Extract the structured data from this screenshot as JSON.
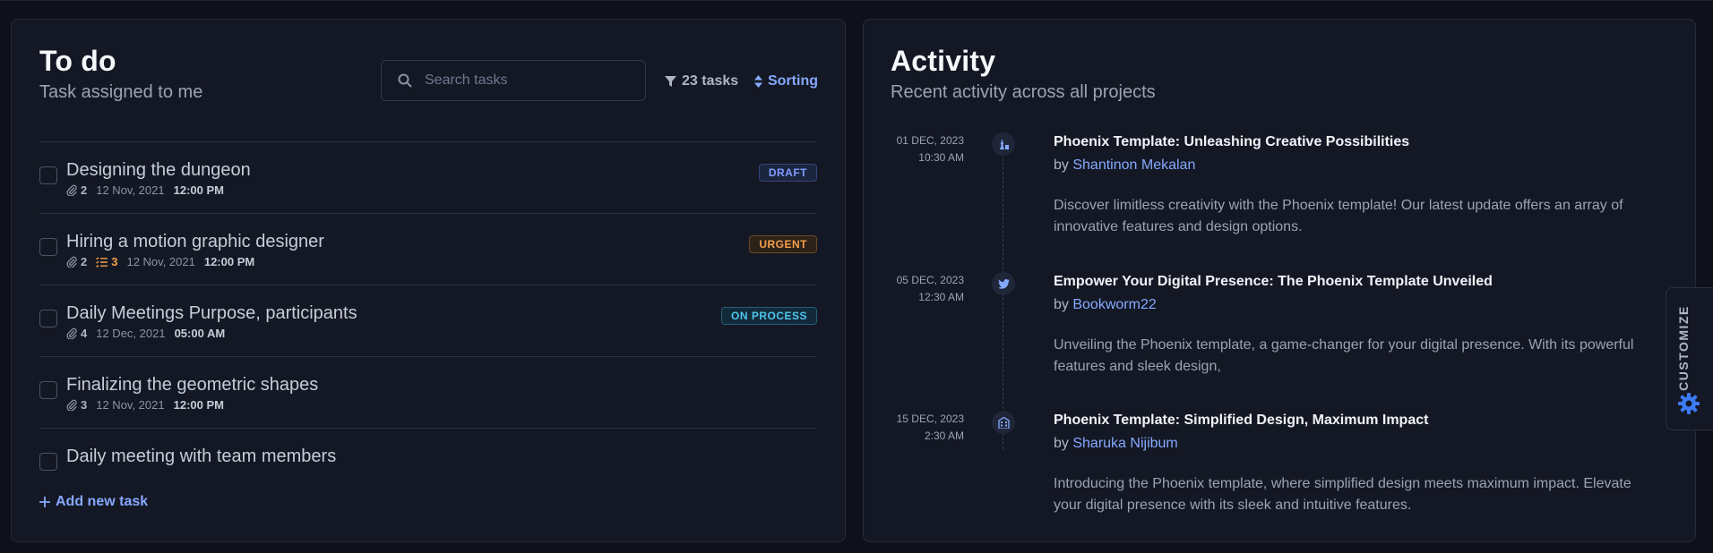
{
  "todo": {
    "title": "To do",
    "subtitle": "Task assigned to me",
    "search_placeholder": "Search tasks",
    "filter_label": "23 tasks",
    "sort_label": "Sorting",
    "add_label": "Add new task",
    "tasks": [
      {
        "title": "Designing the dungeon",
        "attachments": "2",
        "subtasks": "",
        "date": "12 Nov, 2021",
        "time": "12:00 PM",
        "badge": "DRAFT"
      },
      {
        "title": "Hiring a motion graphic designer",
        "attachments": "2",
        "subtasks": "3",
        "date": "12 Nov, 2021",
        "time": "12:00 PM",
        "badge": "URGENT"
      },
      {
        "title": "Daily Meetings Purpose, participants",
        "attachments": "4",
        "subtasks": "",
        "date": "12 Dec, 2021",
        "time": "05:00 AM",
        "badge": "ON PROCESS"
      },
      {
        "title": "Finalizing the geometric shapes",
        "attachments": "3",
        "subtasks": "",
        "date": "12 Nov, 2021",
        "time": "12:00 PM",
        "badge": ""
      },
      {
        "title": "Daily meeting with team members",
        "attachments": "",
        "subtasks": "",
        "date": "",
        "time": "",
        "badge": ""
      }
    ]
  },
  "activity": {
    "title": "Activity",
    "subtitle": "Recent activity across all projects",
    "items": [
      {
        "date": "01 DEC, 2023",
        "time": "10:30 AM",
        "icon": "chess-icon",
        "title": "Phoenix Template: Unleashing Creative Possibilities",
        "by": "by",
        "author": "Shantinon Mekalan",
        "description": "Discover limitless creativity with the Phoenix template! Our latest update offers an array of innovative features and design options."
      },
      {
        "date": "05 DEC, 2023",
        "time": "12:30 AM",
        "icon": "twitter-icon",
        "title": "Empower Your Digital Presence: The Phoenix Template Unveiled",
        "by": "by",
        "author": "Bookworm22",
        "description": "Unveiling the Phoenix template, a game-changer for your digital presence. With its powerful features and sleek design,"
      },
      {
        "date": "15 DEC, 2023",
        "time": "2:30 AM",
        "icon": "building-icon",
        "title": "Phoenix Template: Simplified Design, Maximum Impact",
        "by": "by",
        "author": "Sharuka Nijibum",
        "description": "Introducing the Phoenix template, where simplified design meets maximum impact. Elevate your digital presence with its sleek and intuitive features."
      }
    ]
  },
  "customize": {
    "label": "CUSTOMIZE",
    "icon": "gear-icon"
  },
  "colors": {
    "accent": "#85a9ff",
    "background": "#0f111a",
    "card": "#141824",
    "urgent": "#f5a04a",
    "process": "#4cc7ee"
  }
}
